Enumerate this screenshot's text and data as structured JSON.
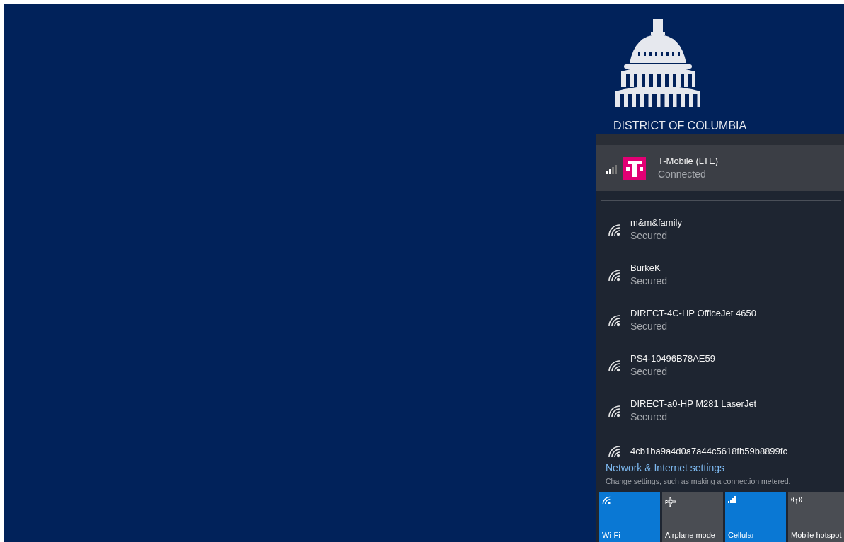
{
  "logo": {
    "text": "DISTRICT OF COLUMBIA"
  },
  "cellular": {
    "name": "T-Mobile (LTE)",
    "status": "Connected"
  },
  "networks": [
    {
      "name": "m&m&family",
      "status": "Secured"
    },
    {
      "name": "BurkeK",
      "status": "Secured"
    },
    {
      "name": "DIRECT-4C-HP OfficeJet 4650",
      "status": "Secured"
    },
    {
      "name": "PS4-10496B78AE59",
      "status": "Secured"
    },
    {
      "name": "DIRECT-a0-HP M281 LaserJet",
      "status": "Secured"
    },
    {
      "name": "4cb1ba9a4d0a7a44c5618fb59b8899fc"
    }
  ],
  "settings_link": "Network & Internet settings",
  "settings_hint": "Change settings, such as making a connection metered.",
  "quick_actions": [
    {
      "kind": "wifi",
      "label": "Wi-Fi",
      "on": true
    },
    {
      "kind": "airplane",
      "label": "Airplane mode",
      "on": false
    },
    {
      "kind": "cellular",
      "label": "Cellular",
      "on": true
    },
    {
      "kind": "hotspot",
      "label": "Mobile hotspot",
      "on": false
    }
  ]
}
